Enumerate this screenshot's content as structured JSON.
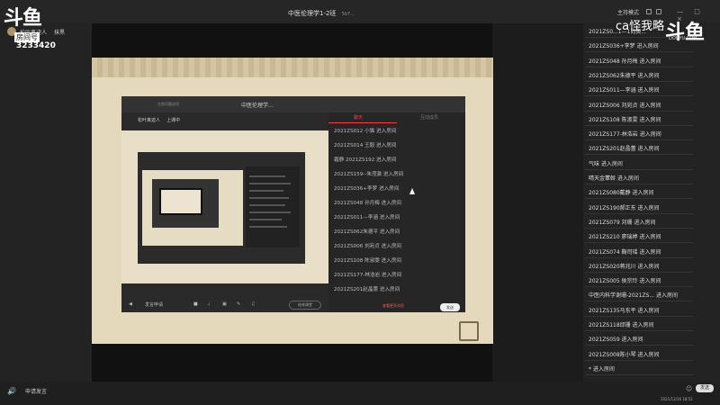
{
  "window": {
    "title": "中医伦理学1-2班",
    "title_sub": "5b7...",
    "mode": "主持模式",
    "controls": "— □ ×"
  },
  "watermark": {
    "logo": "斗鱼",
    "tag": "房间号",
    "room": "3233420",
    "streamer": "ca怪我略",
    "brand": "斗鱼",
    "brand_sub": "DOUYU.COM"
  },
  "left": {
    "user": "松叶禽迹人",
    "mic": "抹黑"
  },
  "inner": {
    "title": "中医伦理学...",
    "left_label": "左侧问题选项",
    "user": "松叶禽迹人",
    "mic": "上课中",
    "tab_chat": "聊天",
    "tab_members": "互动成员",
    "more": "查看更多消息",
    "send": "发送",
    "raise": "发言申请",
    "end": "结束课堂",
    "chat": [
      "2021ZS012 小猫  进入房间",
      "2021ZS014 王毅  进入房间",
      "霜静  2021ZS192 进入房间",
      "2021ZS159--朱滢瀛  进入房间",
      "2021ZS036+李梦  进入房间",
      "2021ZS048 孙月梅  进入房间",
      "2021ZS011—李涵  进入房间",
      "2021ZS062朱德平  进入房间",
      "2021ZS006 刘宛贞  进入房间",
      "2021ZS108 陈淑雯  进入房间",
      "2021ZS177-林浩岩  进入房间",
      "2021ZS201赵晶蕾  进入房间"
    ]
  },
  "danmu": [
    "2021ZS0...1—1尚奥...",
    "2021ZS036+李梦 进入房间",
    "2021ZS048 孙月梅 进入房间",
    "2021ZS062朱德平 进入房间",
    "2021ZS011—李涵 进入房间",
    "2021ZS006 刘宛贞 进入房间",
    "2021ZS108 陈淑雯 进入房间",
    "2021ZS177-林浩岩 进入房间",
    "2021ZS201赵晶蕾 进入房间",
    "气味 进入房间",
    "晴天金蕈斡 进入房间",
    "2021ZS080戴静 进入房间",
    "2021ZS190郝正东 进入房间",
    "2021ZS079 刘珊 进入房间",
    "2021ZS210 廖瑞婷 进入房间",
    "2021ZS074 鞠司瑶 进入房间",
    "2021ZS020蒋兆川 进入房间",
    "2021ZS005 侯宗玲 进入房间",
    "中医内科学谢珊-2021ZS... 进入房间",
    "2021ZS135马东平 进入房间",
    "2021ZS118邱珊 进入房间",
    "2021ZS059 进入房间",
    "2021ZS008陈小琴 进入房间",
    "* 进入房间"
  ],
  "bottom": {
    "speaker": "🔊",
    "raise": "申请发言",
    "send": "发送",
    "clock": "2021/12/16 18:51"
  }
}
